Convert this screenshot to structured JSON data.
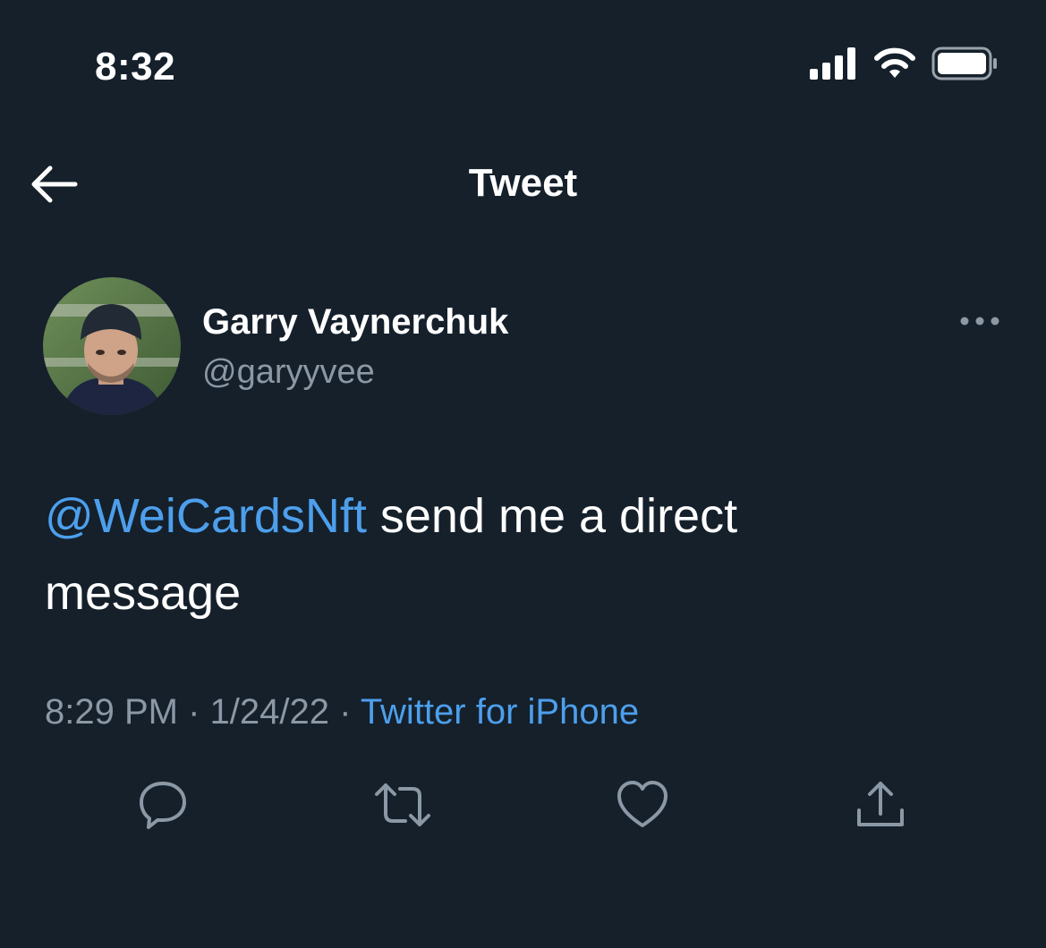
{
  "status_bar": {
    "time": "8:32",
    "icons": [
      "cellular-signal-icon",
      "wifi-icon",
      "battery-icon"
    ]
  },
  "header": {
    "back_icon": "back-arrow-icon",
    "title": "Tweet"
  },
  "tweet": {
    "author": {
      "display_name": "Garry Vaynerchuk",
      "handle": "@garyyvee",
      "avatar_icon": "avatar-photo"
    },
    "more_icon": "more-options-icon",
    "mention": "@WeiCardsNft",
    "body_line_1": " send me a direct",
    "body_line_2": "message",
    "time": "8:29 PM",
    "separator_1": " · ",
    "date": "1/24/22",
    "separator_2": " · ",
    "source": "Twitter for iPhone"
  },
  "actions": [
    "reply-icon",
    "retweet-icon",
    "like-icon",
    "share-icon"
  ],
  "colors": {
    "background": "#15202b",
    "text_primary": "#ffffff",
    "text_secondary": "#8b98a5",
    "accent": "#4d9fec"
  }
}
